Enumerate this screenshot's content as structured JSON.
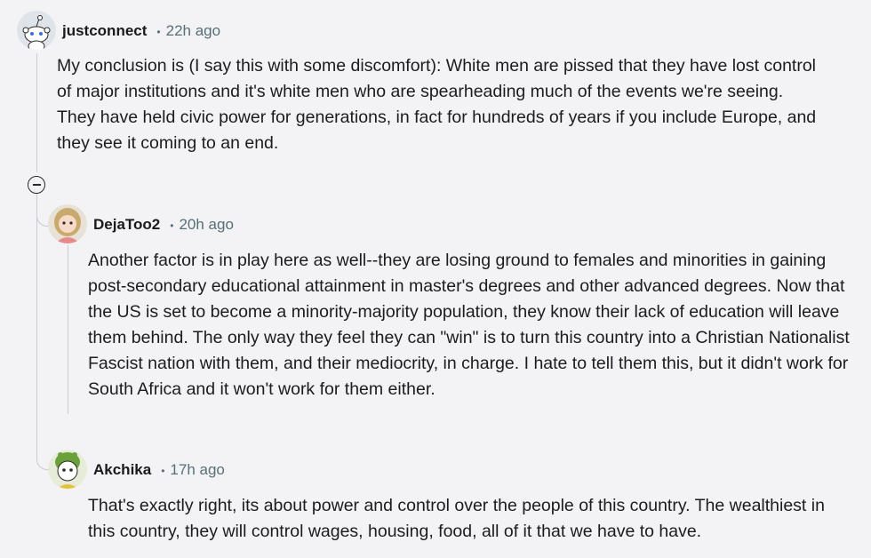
{
  "comments": [
    {
      "username": "justconnect",
      "time": "22h ago",
      "body": "My conclusion is (I say this with some discomfort): White men are pissed that they have lost control of major institutions and it's white men who are spearheading much of the events we're seeing. They have held civic power for generations, in fact for hundreds of years if you include Europe, and they see it coming to an end."
    },
    {
      "username": "DejaToo2",
      "time": "20h ago",
      "body": "Another factor is in play here as well--they are losing ground to females and minorities in gaining post-secondary educational attainment in master's degrees and other advanced degrees. Now that the US is set to become a minority-majority population, they know their lack of education will leave them behind. The only way they feel they can \"win\" is to turn this country into a Christian Nationalist Fascist nation with them, and their mediocrity, in charge. I hate to tell them this, but it didn't work for South Africa and it won't work for them either."
    },
    {
      "username": "Akchika",
      "time": "17h ago",
      "body": "That's exactly right, its about power and control over the people of this country. The wealthiest in this country, they will control wages, housing, food, all of it that we have to have."
    }
  ],
  "separator": "•",
  "icons": {
    "collapse": "collapse-minus-icon"
  },
  "colors": {
    "background": "#f3f3f6",
    "meta": "#576f76",
    "thread_line": "#c9cbd3"
  }
}
